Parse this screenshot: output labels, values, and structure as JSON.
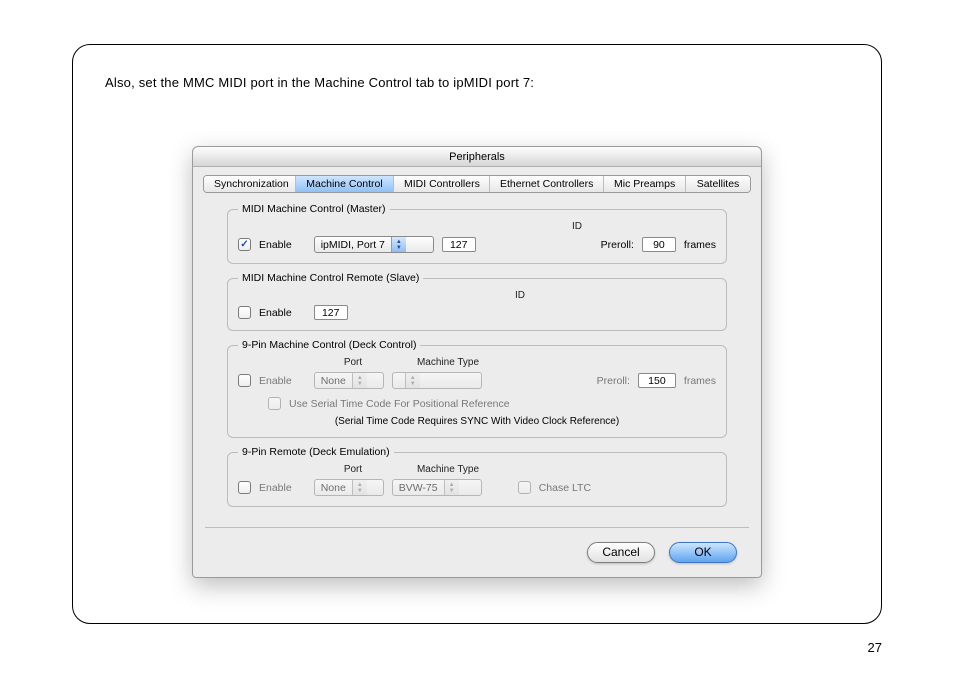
{
  "instruction": "Also, set the MMC MIDI port in the Machine Control tab to ipMIDI port 7:",
  "page_number": "27",
  "dialog": {
    "title": "Peripherals",
    "tabs": [
      "Synchronization",
      "Machine Control",
      "MIDI Controllers",
      "Ethernet Controllers",
      "Mic Preamps",
      "Satellites"
    ],
    "active_tab": "Machine Control",
    "footer": {
      "cancel": "Cancel",
      "ok": "OK"
    }
  },
  "mmc_master": {
    "legend": "MIDI Machine Control (Master)",
    "enable_label": "Enable",
    "enabled": true,
    "port": "ipMIDI, Port 7",
    "id_label": "ID",
    "id": "127",
    "preroll_label": "Preroll:",
    "preroll": "90",
    "frames_label": "frames"
  },
  "mmc_slave": {
    "legend": "MIDI Machine Control Remote (Slave)",
    "enable_label": "Enable",
    "enabled": false,
    "id_label": "ID",
    "id": "127"
  },
  "nine_pin_deck": {
    "legend": "9-Pin Machine Control (Deck Control)",
    "enable_label": "Enable",
    "enabled": false,
    "port_header": "Port",
    "machine_header": "Machine Type",
    "port": "None",
    "machine": "",
    "preroll_label": "Preroll:",
    "preroll": "150",
    "frames_label": "frames",
    "serial_check_label": "Use Serial Time Code For Positional Reference",
    "serial_checked": false,
    "note": "(Serial Time Code Requires SYNC With Video Clock Reference)"
  },
  "nine_pin_remote": {
    "legend": "9-Pin Remote (Deck Emulation)",
    "enable_label": "Enable",
    "enabled": false,
    "port_header": "Port",
    "machine_header": "Machine Type",
    "port": "None",
    "machine": "BVW-75",
    "chase_label": "Chase LTC",
    "chase_checked": false
  }
}
